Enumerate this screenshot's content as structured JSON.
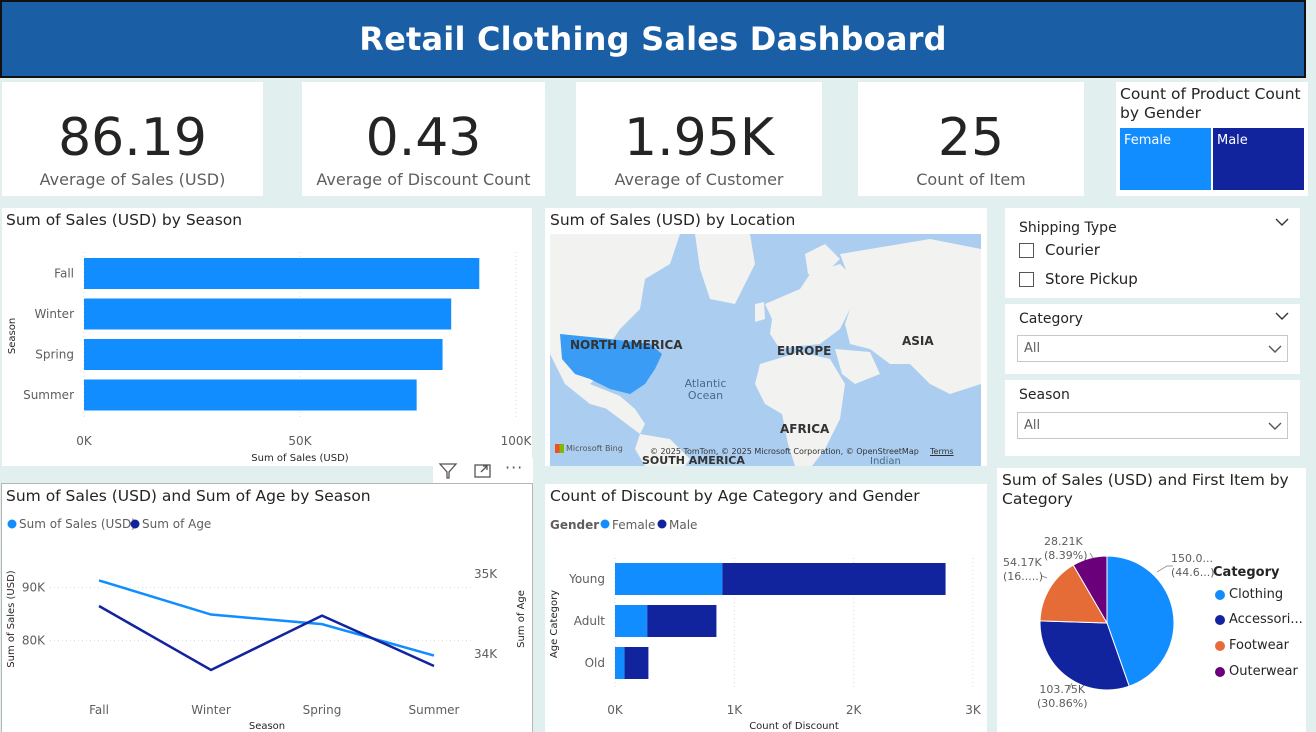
{
  "header": {
    "title": "Retail Clothing Sales Dashboard"
  },
  "kpis": [
    {
      "value": "86.19",
      "label": "Average of Sales (USD)"
    },
    {
      "value": "0.43",
      "label": "Average of Discount Count"
    },
    {
      "value": "1.95K",
      "label": "Average of Customer"
    },
    {
      "value": "25",
      "label": "Count of Item"
    }
  ],
  "gender_treemap": {
    "title": "Count of Product Count by Gender",
    "items": [
      {
        "label": "Female",
        "color": "#118dff"
      },
      {
        "label": "Male",
        "color": "#12239e"
      }
    ]
  },
  "season_bar": {
    "title": "Sum of Sales (USD) by Season"
  },
  "map": {
    "title": "Sum of Sales (USD) by Location",
    "labels": {
      "north_america": "NORTH AMERICA",
      "europe": "EUROPE",
      "asia": "ASIA",
      "africa": "AFRICA",
      "south_america": "SOUTH AMERICA",
      "ocean": "Atlantic Ocean",
      "indian": "Indian"
    },
    "attribution": "© 2025 TomTom, © 2025 Microsoft Corporation, © OpenStreetMap",
    "terms": "Terms",
    "bing": "Microsoft Bing"
  },
  "visual_header": {
    "filter_icon": "filter-icon",
    "focus_icon": "focus-mode-icon",
    "more_icon": "more-options-icon",
    "more_label": "···"
  },
  "line_chart": {
    "title": "Sum of Sales (USD) and Sum of Age by Season"
  },
  "discount_chart": {
    "title": "Count of Discount by Age Category and Gender"
  },
  "pie_chart": {
    "title": "Sum of Sales (USD) and First Item by Category",
    "legend_title": "Category",
    "legend": [
      "Clothing",
      "Accessori...",
      "Footwear",
      "Outerwear"
    ],
    "data_labels": [
      "150.0...",
      "(44.6...)",
      "103.75K",
      "(30.86%)",
      "54.17K",
      "(16.....)",
      "28.21K",
      "(8.39%)"
    ]
  },
  "slicers": {
    "shipping": {
      "title": "Shipping Type",
      "options": [
        "Courier",
        "Store Pickup"
      ]
    },
    "category": {
      "title": "Category",
      "value": "All"
    },
    "season": {
      "title": "Season",
      "value": "All"
    }
  },
  "colors": {
    "primary": "#118dff",
    "dark": "#12239e",
    "orange": "#e66c37",
    "purple": "#6b007b",
    "header": "#1a5fa6"
  },
  "chart_data": [
    {
      "type": "bar",
      "title": "Sum of Sales (USD) by Season",
      "categories": [
        "Fall",
        "Winter",
        "Spring",
        "Summer"
      ],
      "values": [
        91500,
        85000,
        83000,
        77000
      ],
      "xlabel": "Sum of Sales (USD)",
      "ylabel": "Season",
      "xticks": [
        "0K",
        "50K",
        "100K"
      ],
      "xlim": [
        0,
        100000
      ]
    },
    {
      "type": "line",
      "title": "Sum of Sales (USD) and Sum of Age by Season",
      "categories": [
        "Fall",
        "Winter",
        "Spring",
        "Summer"
      ],
      "series": [
        {
          "name": "Sum of Sales (USD)",
          "axis": "left",
          "color": "#118dff",
          "values": [
            91300,
            84900,
            83100,
            77200
          ]
        },
        {
          "name": "Sum of Age",
          "axis": "right",
          "color": "#12239e",
          "values": [
            34.6,
            33.8,
            34.48,
            33.85
          ]
        }
      ],
      "xlabel": "Season",
      "ylabel_left": "Sum of Sales (USD)",
      "ylabel_right": "Sum of Age",
      "left_ticks": [
        "80K",
        "90K"
      ],
      "right_ticks": [
        "34K",
        "35K"
      ],
      "left_ylim": [
        70000,
        100000
      ],
      "right_ylim": [
        33.5,
        35.5
      ]
    },
    {
      "type": "bar",
      "title": "Count of Discount by Age Category and Gender",
      "categories": [
        "Young",
        "Adult",
        "Old"
      ],
      "series": [
        {
          "name": "Female",
          "color": "#118dff",
          "values": [
            900,
            270,
            80
          ]
        },
        {
          "name": "Male",
          "color": "#12239e",
          "values": [
            1870,
            580,
            200
          ]
        }
      ],
      "legend_title": "Gender",
      "xlabel": "Count of Discount",
      "ylabel": "Age Category",
      "xticks": [
        "0K",
        "1K",
        "2K",
        "3K"
      ],
      "xlim": [
        0,
        3000
      ]
    },
    {
      "type": "pie",
      "title": "Sum of Sales (USD) and First Item by Category",
      "categories": [
        "Clothing",
        "Accessories",
        "Footwear",
        "Outerwear"
      ],
      "values": [
        44.6,
        30.86,
        16.1,
        8.39
      ],
      "colors": [
        "#118dff",
        "#12239e",
        "#e66c37",
        "#6b007b"
      ]
    }
  ]
}
